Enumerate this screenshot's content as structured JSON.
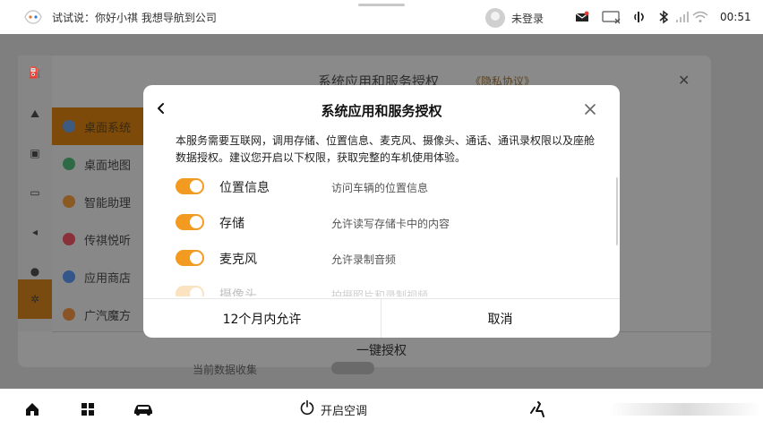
{
  "status_bar": {
    "voice_hint": "试试说：你好小祺 我想导航到公司",
    "login_status": "未登录",
    "time": "00:51",
    "icons": [
      "assistant-logo-icon",
      "avatar",
      "message-icon",
      "tv-disabled-icon",
      "nfc-icon",
      "bluetooth-icon",
      "signal-icon",
      "wifi-icon"
    ]
  },
  "background": {
    "title": "系统应用和服务授权",
    "privacy_link": "《隐私协议》",
    "menu": [
      {
        "label": "桌面系统",
        "color": "#3d6fb8"
      },
      {
        "label": "桌面地图",
        "color": "#2e9a5a"
      },
      {
        "label": "智能助理",
        "color": "#d98a2a"
      },
      {
        "label": "传祺悦听",
        "color": "#d2404a"
      },
      {
        "label": "应用商店",
        "color": "#3a78d0"
      },
      {
        "label": "广汽魔方",
        "color": "#e07a2a"
      }
    ],
    "one_key_label": "一键授权",
    "bottom_text": "当前数据收集"
  },
  "dialog": {
    "title": "系统应用和服务授权",
    "description": "本服务需要互联网，调用存储、位置信息、麦克风、摄像头、通话、通讯录权限以及座舱数据授权。建议您开启以下权限，获取完整的车机使用体验。",
    "permissions": [
      {
        "name": "位置信息",
        "desc": "访问车辆的位置信息",
        "enabled": true
      },
      {
        "name": "存储",
        "desc": "允许读写存储卡中的内容",
        "enabled": true
      },
      {
        "name": "麦克风",
        "desc": "允许录制音频",
        "enabled": true
      },
      {
        "name": "摄像头",
        "desc": "拍摄照片和录制视频",
        "enabled": true
      }
    ],
    "allow_button": "12个月内允许",
    "cancel_button": "取消",
    "accent_color": "#f39a21"
  },
  "dock": {
    "ac_label": "开启空调",
    "icons": [
      "home-icon",
      "apps-grid-icon",
      "car-icon",
      "power-icon",
      "seat-icon"
    ]
  }
}
